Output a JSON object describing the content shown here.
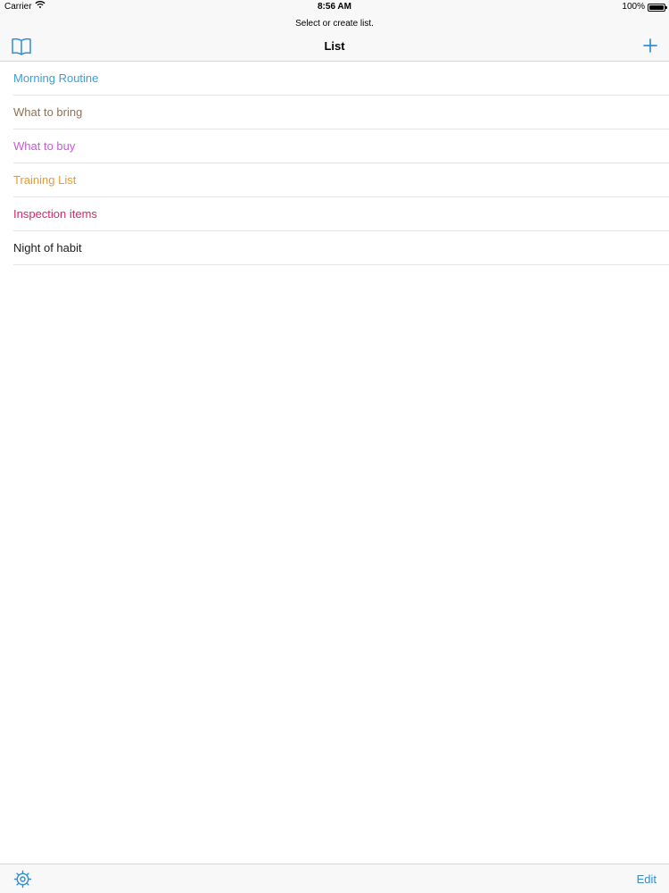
{
  "status_bar": {
    "carrier": "Carrier",
    "time": "8:56 AM",
    "battery": "100%"
  },
  "nav": {
    "prompt": "Select or create list.",
    "title": "List",
    "left_icon": "book-icon",
    "right_icon": "plus-icon"
  },
  "lists": [
    {
      "label": "Morning Routine",
      "color": "#3a9fd6"
    },
    {
      "label": "What to bring",
      "color": "#8f7352"
    },
    {
      "label": "What to buy",
      "color": "#c85ad8"
    },
    {
      "label": "Training List",
      "color": "#e99a2f"
    },
    {
      "label": "Inspection items",
      "color": "#d8246a"
    },
    {
      "label": "Night of habit",
      "color": "#1c1c1c"
    }
  ],
  "toolbar": {
    "settings_icon": "gear-icon",
    "edit_label": "Edit"
  },
  "colors": {
    "accent": "#2f8ed4",
    "bar_background": "#f8f8f9"
  }
}
